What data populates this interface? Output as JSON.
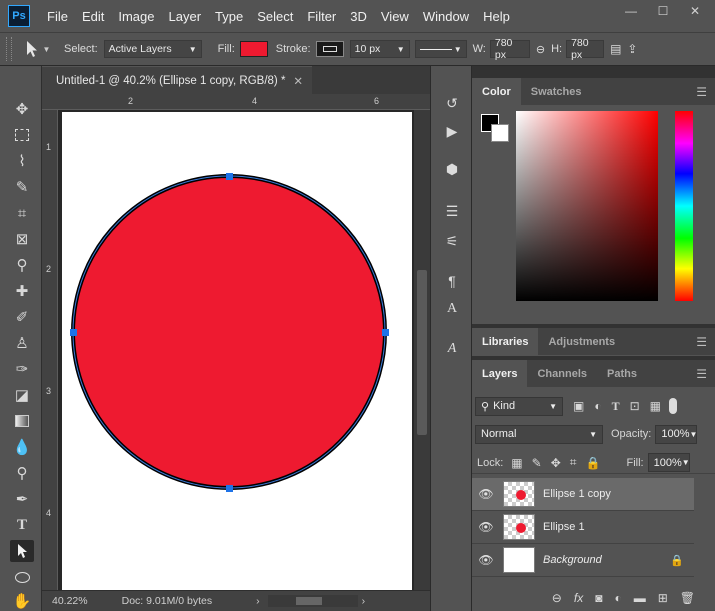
{
  "app": {
    "logo": "Ps"
  },
  "menu": [
    "File",
    "Edit",
    "Image",
    "Layer",
    "Type",
    "Select",
    "Filter",
    "3D",
    "View",
    "Window",
    "Help"
  ],
  "window_controls": {
    "minimize": "—",
    "maximize": "☐",
    "close": "✕"
  },
  "options": {
    "select_label": "Select:",
    "select_value": "Active Layers",
    "fill_label": "Fill:",
    "fill_color": "#ee1a30",
    "stroke_label": "Stroke:",
    "stroke_width": "10 px",
    "w_label": "W:",
    "w_value": "780 px",
    "h_label": "H:",
    "h_value": "780 px"
  },
  "document": {
    "tab_title": "Untitled-1 @ 40.2% (Ellipse 1 copy, RGB/8) *",
    "close": "✕",
    "zoom": "40.22%",
    "doc_info": "Doc: 9.01M/0 bytes"
  },
  "ruler": {
    "h": [
      "2",
      "4",
      "6"
    ],
    "v": [
      "1",
      "2",
      "3",
      "4"
    ]
  },
  "canvas": {
    "ellipse_fill": "#ee1a30",
    "ellipse_stroke": "#000000",
    "handle_color": "#1e73e8"
  },
  "color_panel": {
    "tabs": [
      "Color",
      "Swatches"
    ]
  },
  "libraries_panel": {
    "tabs": [
      "Libraries",
      "Adjustments"
    ]
  },
  "layers_panel": {
    "tabs": [
      "Layers",
      "Channels",
      "Paths"
    ],
    "kind": "Kind",
    "blend": "Normal",
    "opacity_label": "Opacity:",
    "opacity": "100%",
    "lock_label": "Lock:",
    "fill_label": "Fill:",
    "fill": "100%",
    "layers": [
      {
        "name": "Ellipse 1 copy",
        "selected": true
      },
      {
        "name": "Ellipse 1",
        "selected": false
      },
      {
        "name": "Background",
        "selected": false
      }
    ]
  }
}
